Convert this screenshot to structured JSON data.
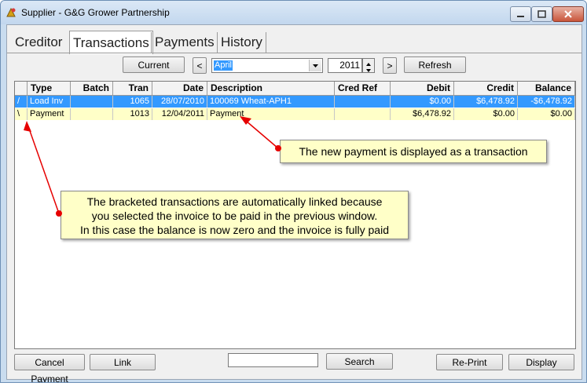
{
  "window": {
    "title": "Supplier - G&G Grower Partnership"
  },
  "tabs": [
    "Creditor",
    "Transactions",
    "Payments",
    "History"
  ],
  "toolbar": {
    "current_label": "Current",
    "prev_label": "<",
    "month_value": "April",
    "year_value": "2011",
    "next_label": ">",
    "refresh_label": "Refresh"
  },
  "table": {
    "columns": [
      "Type",
      "Batch",
      "Tran",
      "Date",
      "Description",
      "Cred Ref",
      "Debit",
      "Credit",
      "Balance"
    ],
    "rows": [
      {
        "type": "Load Inv",
        "batch": "",
        "tran": "1065",
        "date": "28/07/2010",
        "description": "100069 Wheat-APH1",
        "cred_ref": "",
        "debit": "$0.00",
        "credit": "$6,478.92",
        "balance": "-$6,478.92"
      },
      {
        "type": "Payment",
        "batch": "",
        "tran": "1013",
        "date": "12/04/2011",
        "description": "Payment",
        "cred_ref": "",
        "debit": "$6,478.92",
        "credit": "$0.00",
        "balance": "$0.00"
      }
    ]
  },
  "callouts": {
    "new_payment": "The new payment is displayed as a transaction",
    "linked_line1": "The bracketed transactions are automatically linked because",
    "linked_line2": "you selected the invoice to be paid in the previous window.",
    "linked_line3": "In this case the balance is now zero and the invoice is fully paid"
  },
  "footer": {
    "cancel_payment_label": "Cancel Payment",
    "link_label": "Link",
    "search_value": "",
    "search_label": "Search",
    "reprint_label": "Re-Print",
    "display_label": "Display"
  },
  "colors": {
    "selection": "#3399ff",
    "highlight_row": "#ffffc8",
    "arrow": "#e60000"
  }
}
